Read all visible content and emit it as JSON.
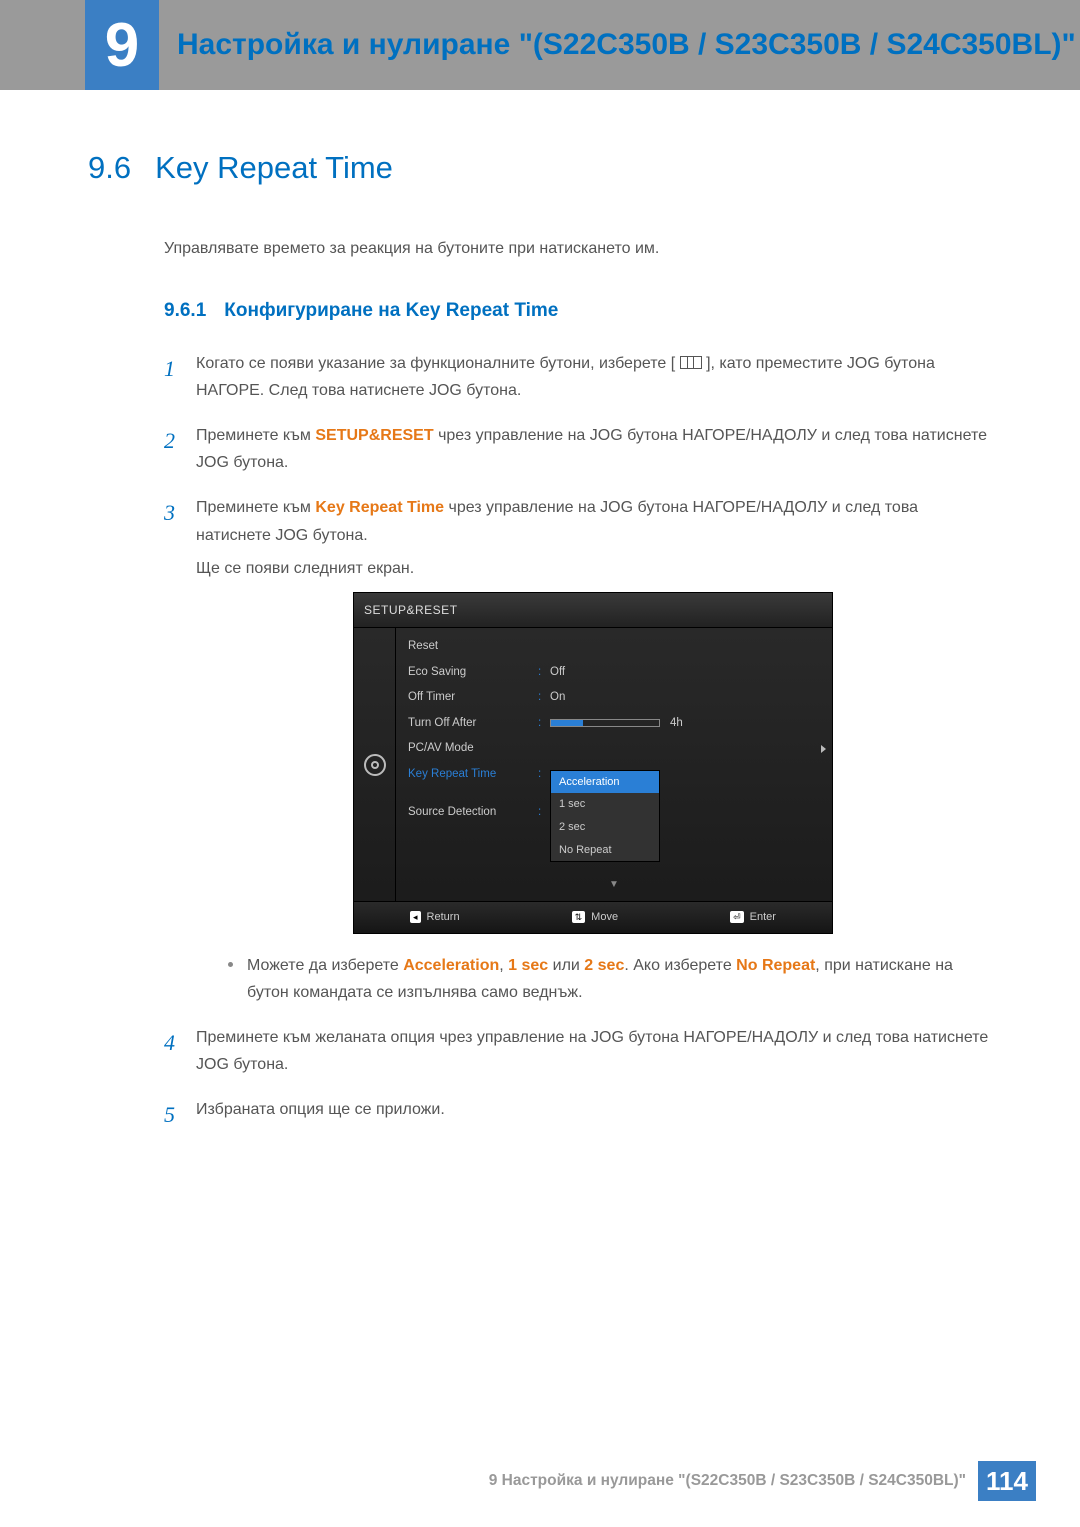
{
  "header": {
    "chapter_number": "9",
    "chapter_title": "Настройка и нулиране \"(S22C350B / S23C350B / S24C350BL)\""
  },
  "section": {
    "number": "9.6",
    "title": "Key Repeat Time",
    "description": "Управлявате времето за реакция на бутоните при натискането им."
  },
  "subsection": {
    "number": "9.6.1",
    "title": "Конфигуриране на Key Repeat Time"
  },
  "steps": {
    "s1_a": "Когато се появи указание за функционалните бутони, изберете [",
    "s1_b": "], като преместите JOG бутона НАГОРЕ. След това натиснете JOG бутона.",
    "s2_a": "Преминете към ",
    "s2_kw": "SETUP&RESET",
    "s2_b": " чрез управление на JOG бутона НАГОРЕ/НАДОЛУ и след това натиснете JOG бутона.",
    "s3_a": "Преминете към ",
    "s3_kw": "Key Repeat Time",
    "s3_b": " чрез управление на JOG бутона НАГОРЕ/НАДОЛУ и след това натиснете JOG бутона.",
    "s3_note": "Ще се появи следният екран.",
    "bullet_a": "Можете да изберете ",
    "bullet_k1": "Acceleration",
    "bullet_sep1": ", ",
    "bullet_k2": "1 sec",
    "bullet_sep2": " или ",
    "bullet_k3": "2 sec",
    "bullet_b": ". Ако изберете ",
    "bullet_k4": "No Repeat",
    "bullet_c": ", при натискане на бутон командата се изпълнява само веднъж.",
    "s4": "Преминете към желаната опция чрез управление на JOG бутона НАГОРЕ/НАДОЛУ и след това натиснете JOG бутона.",
    "s5": "Избраната опция ще се приложи."
  },
  "osd": {
    "title": "SETUP&RESET",
    "rows": {
      "reset": "Reset",
      "eco": "Eco Saving",
      "eco_val": "Off",
      "off_timer": "Off Timer",
      "off_timer_val": "On",
      "turn_off": "Turn Off After",
      "turn_off_val": "4h",
      "pcav": "PC/AV Mode",
      "krt": "Key Repeat Time",
      "src": "Source Detection"
    },
    "options": {
      "o1": "Acceleration",
      "o2": "1 sec",
      "o3": "2 sec",
      "o4": "No Repeat"
    },
    "footer": {
      "return": "Return",
      "move": "Move",
      "enter": "Enter"
    }
  },
  "footer": {
    "text": "9 Настройка и нулиране \"(S22C350B / S23C350B / S24C350BL)\"",
    "page": "114"
  }
}
